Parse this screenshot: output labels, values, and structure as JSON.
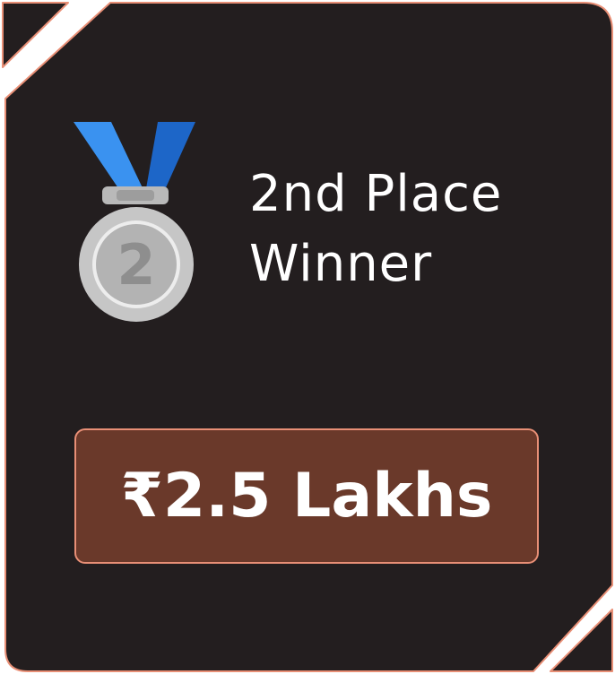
{
  "card": {
    "title_line1": "2nd Place",
    "title_line2": "Winner",
    "prize": "₹2.5 Lakhs"
  },
  "medal": {
    "icon": "second-place-medal-icon",
    "digit": "2"
  },
  "colors": {
    "card_background": "#231e1f",
    "card_border": "#e88f76",
    "prize_background": "#6a392a",
    "ribbon_light": "#3a92f0",
    "ribbon_dark": "#1d66c8",
    "medal_silver": "#c7c7c7",
    "text": "#ffffff"
  }
}
